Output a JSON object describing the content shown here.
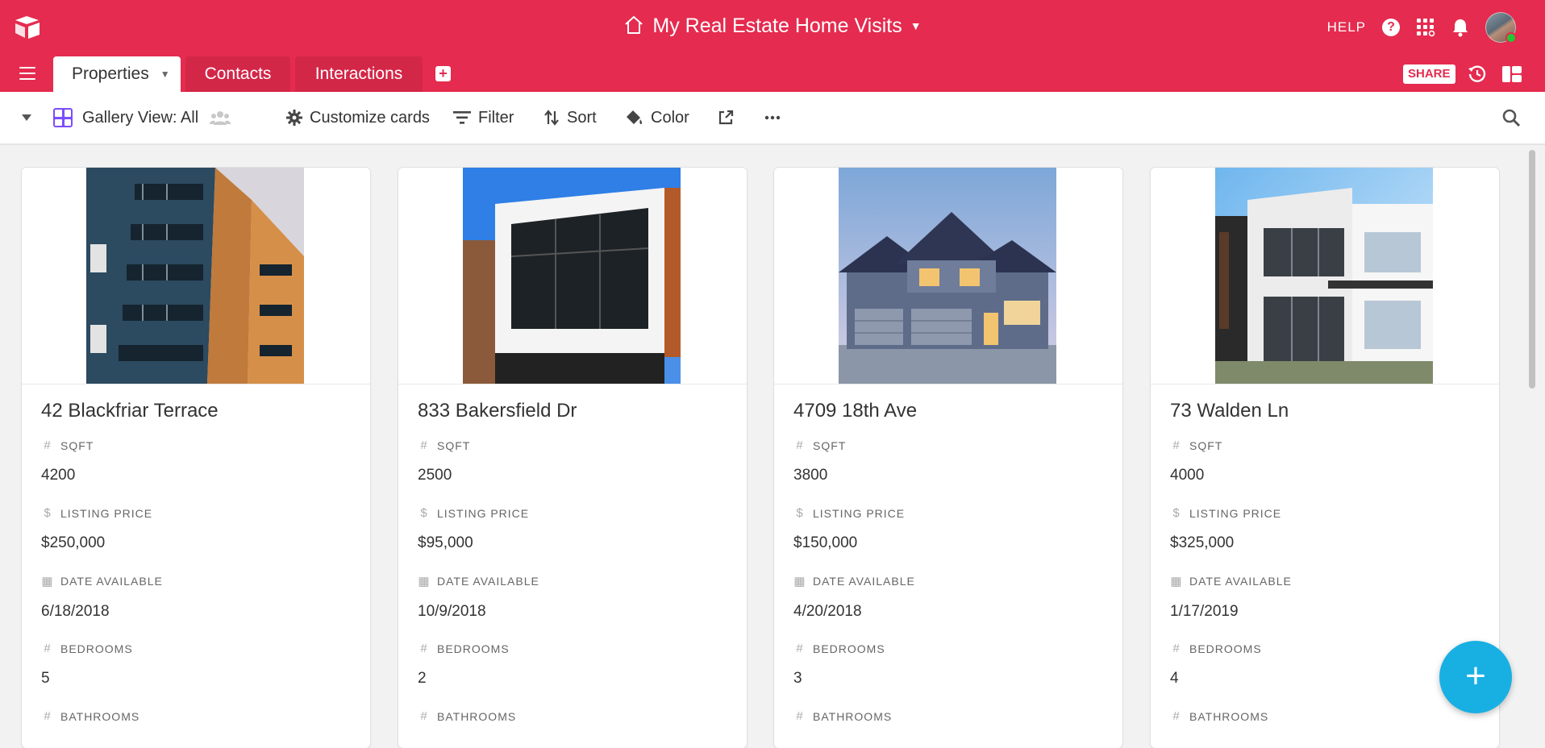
{
  "base": {
    "title": "My Real Estate Home Visits"
  },
  "header": {
    "help_label": "HELP"
  },
  "tabs": [
    {
      "label": "Properties"
    },
    {
      "label": "Contacts"
    },
    {
      "label": "Interactions"
    }
  ],
  "share_label": "SHARE",
  "viewbar": {
    "view_name": "Gallery View: All",
    "customize": "Customize cards",
    "filter": "Filter",
    "sort": "Sort",
    "color": "Color"
  },
  "field_labels": {
    "sqft": "SQFT",
    "price": "LISTING PRICE",
    "date": "DATE AVAILABLE",
    "bedrooms": "BEDROOMS",
    "bathrooms": "BATHROOMS"
  },
  "cards": [
    {
      "title": "42 Blackfriar Terrace",
      "sqft": "4200",
      "price": "$250,000",
      "date": "6/18/2018",
      "bedrooms": "5"
    },
    {
      "title": "833 Bakersfield Dr",
      "sqft": "2500",
      "price": "$95,000",
      "date": "10/9/2018",
      "bedrooms": "2"
    },
    {
      "title": "4709 18th Ave",
      "sqft": "3800",
      "price": "$150,000",
      "date": "4/20/2018",
      "bedrooms": "3"
    },
    {
      "title": "73 Walden Ln",
      "sqft": "4000",
      "price": "$325,000",
      "date": "1/17/2019",
      "bedrooms": "4"
    }
  ],
  "colors": {
    "brand": "#e52b4f",
    "fab": "#18b0e3",
    "view_icon": "#7c4dff"
  }
}
